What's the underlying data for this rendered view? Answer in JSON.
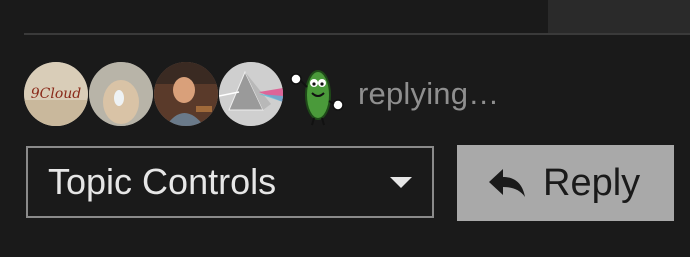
{
  "replying": {
    "avatars": [
      {
        "name": "9cloud-avatar",
        "text": "9Cloud"
      },
      {
        "name": "hand-avatar"
      },
      {
        "name": "man-avatar"
      },
      {
        "name": "prism-avatar"
      },
      {
        "name": "pickle-avatar"
      }
    ],
    "status_text": "replying…"
  },
  "controls": {
    "topic_controls_label": "Topic Controls",
    "reply_label": "Reply"
  },
  "colors": {
    "background": "#1a1a1a",
    "status_text": "#8f8f8f",
    "reply_button_bg": "#a9a9a9",
    "topic_border": "#8a8a8a"
  },
  "icons": {
    "dropdown": "chevron-down-icon",
    "reply": "reply-arrow-icon"
  }
}
